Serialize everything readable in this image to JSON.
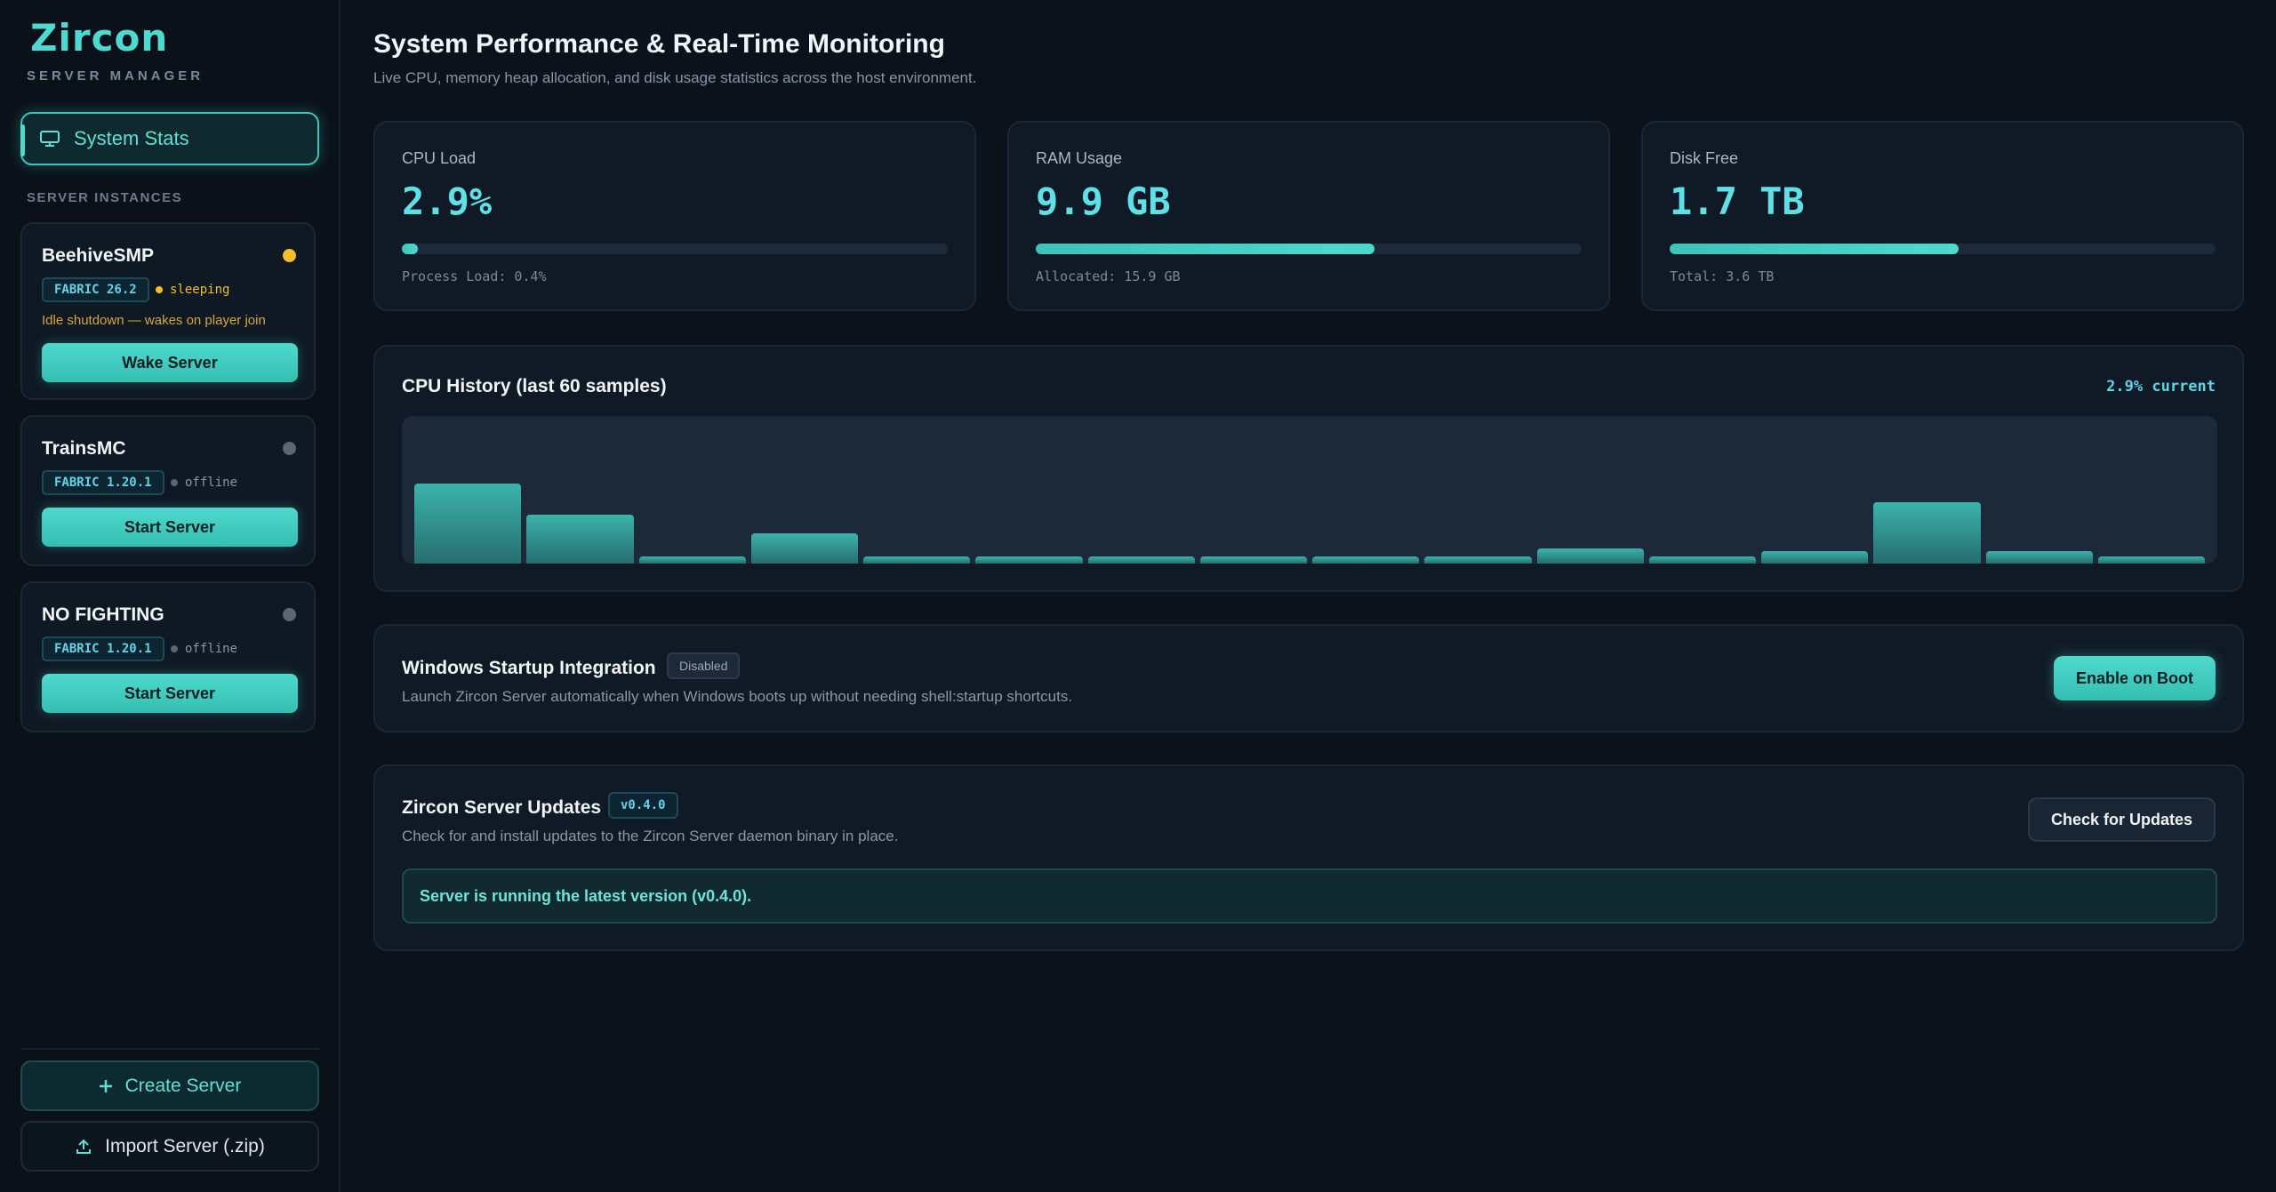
{
  "app": {
    "logo": "Zircon",
    "subtitle": "SERVER MANAGER"
  },
  "nav": {
    "system_stats_label": "System Stats",
    "section_label": "SERVER INSTANCES"
  },
  "instances": [
    {
      "name": "BeehiveSMP",
      "badge": "FABRIC 26.2",
      "status": "sleeping",
      "status_color": "#f4bf2a",
      "note": "Idle shutdown — wakes on player join",
      "button": "Wake Server"
    },
    {
      "name": "TrainsMC",
      "badge": "FABRIC 1.20.1",
      "status": "offline",
      "status_color": "#5b6673",
      "button": "Start Server"
    },
    {
      "name": "NO FIGHTING",
      "badge": "FABRIC 1.20.1",
      "status": "offline",
      "status_color": "#5b6673",
      "button": "Start Server"
    }
  ],
  "sidebar_footer": {
    "create_label": "Create Server",
    "import_label": "Import Server (.zip)"
  },
  "header": {
    "title": "System Performance & Real-Time Monitoring",
    "subtitle": "Live CPU, memory heap allocation, and disk usage statistics across the host environment."
  },
  "stats": {
    "cpu": {
      "label": "CPU Load",
      "value": "2.9%",
      "footer": "Process Load: 0.4%",
      "fill_fraction": 0.029
    },
    "ram": {
      "label": "RAM Usage",
      "value": "9.9 GB",
      "footer": "Allocated: 15.9 GB",
      "fill_fraction": 0.62
    },
    "disk": {
      "label": "Disk Free",
      "value": "1.7 TB",
      "footer": "Total: 3.6 TB",
      "fill_fraction": 0.53
    }
  },
  "cpu_history": {
    "title": "CPU History (last 60 samples)",
    "current": "2.9% current",
    "bar_percent": [
      12.3,
      7.6,
      1.1,
      4.6,
      1.1,
      1.1,
      1.1,
      1.1,
      1.1,
      1.1,
      2.3,
      1.1,
      1.9,
      9.5,
      1.9,
      1.1
    ],
    "y_max_percent": 20
  },
  "startup": {
    "title": "Windows Startup Integration",
    "badge": "Disabled",
    "description": "Launch Zircon Server automatically when Windows boots up without needing shell:startup shortcuts.",
    "button": "Enable on Boot"
  },
  "updates": {
    "title": "Zircon Server Updates",
    "version": "v0.4.0",
    "description": "Check for and install updates to the Zircon Server daemon binary in place.",
    "button": "Check for Updates",
    "status": "Server is running the latest version (v0.4.0)."
  },
  "colors": {
    "accent": "#4ed8cf",
    "background": "#0b121c",
    "card": "#101a26"
  },
  "icons": {
    "nav": "monitor-icon",
    "create": "plus-icon",
    "import": "upload-icon"
  }
}
